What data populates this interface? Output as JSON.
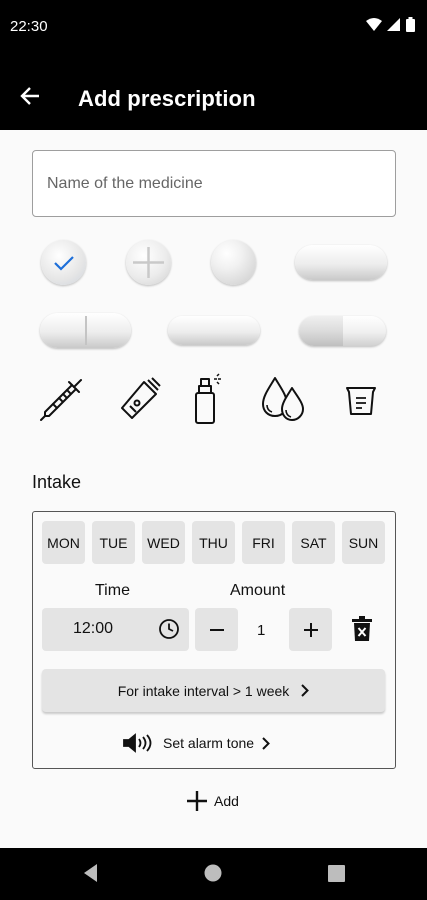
{
  "status_bar": {
    "time": "22:30"
  },
  "app_bar": {
    "title": "Add prescription"
  },
  "name_field": {
    "placeholder": "Name of the medicine",
    "value": ""
  },
  "shapes": [
    {
      "name": "round-pill-selected",
      "selected": true
    },
    {
      "name": "scored-round-pill",
      "selected": false
    },
    {
      "name": "softgel-pill",
      "selected": false
    },
    {
      "name": "oval-pill",
      "selected": false
    },
    {
      "name": "scored-capsule-pill",
      "selected": false
    },
    {
      "name": "capsule-pill",
      "selected": false
    },
    {
      "name": "two-tone-capsule-pill",
      "selected": false
    },
    {
      "name": "syringe-icon",
      "selected": false
    },
    {
      "name": "ointment-tube-icon",
      "selected": false
    },
    {
      "name": "spray-bottle-icon",
      "selected": false
    },
    {
      "name": "drops-icon",
      "selected": false
    },
    {
      "name": "measuring-cup-icon",
      "selected": false
    }
  ],
  "intake": {
    "label": "Intake",
    "days": [
      "MON",
      "TUE",
      "WED",
      "THU",
      "FRI",
      "SAT",
      "SUN"
    ],
    "time_label": "Time",
    "amount_label": "Amount",
    "time_value": "12:00",
    "amount_value": "1",
    "interval_button": "For intake interval > 1 week",
    "alarm_label": "Set alarm tone"
  },
  "add_label": "Add",
  "colors": {
    "accent": "#1e6fd9",
    "bar": "#000000",
    "chip": "#e4e4e4"
  }
}
